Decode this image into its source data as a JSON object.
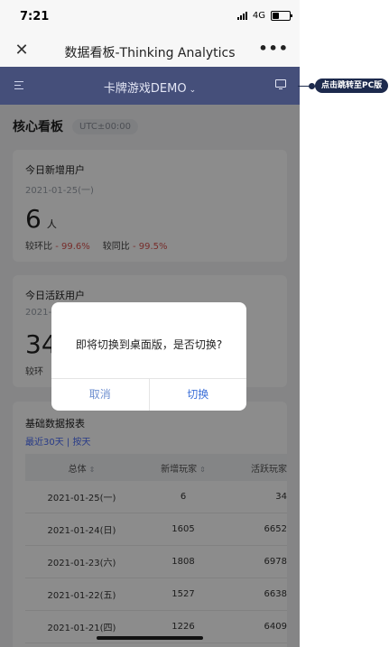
{
  "status_bar": {
    "time": "7:21",
    "network": "4G"
  },
  "title_bar": {
    "close_icon": "close-icon",
    "title": "数据看板-Thinking Analytics",
    "more_label": "•••"
  },
  "app_header": {
    "menu_icon": "menu-icon",
    "project": "卡牌游戏DEMO",
    "desktop_icon": "desktop-icon"
  },
  "section": {
    "title": "核心看板",
    "timezone": "UTC±00:00"
  },
  "card_new_users": {
    "title": "今日新增用户",
    "date": "2021-01-25(一)",
    "value": "6",
    "unit": "人",
    "mom_label": "较环比",
    "mom_value": "- 99.6%",
    "yoy_label": "较同比",
    "yoy_value": "- 99.5%"
  },
  "card_active_users": {
    "title": "今日活跃用户",
    "date_partial": "2021-",
    "value_partial": "34",
    "compare_partial": "较环"
  },
  "report": {
    "title": "基础数据报表",
    "subtitle": "最近30天 | 按天",
    "headers": [
      "总体",
      "新增玩家",
      "活跃玩家"
    ],
    "rows": [
      [
        "2021-01-25(一)",
        "6",
        "34"
      ],
      [
        "2021-01-24(日)",
        "1605",
        "6652"
      ],
      [
        "2021-01-23(六)",
        "1808",
        "6978"
      ],
      [
        "2021-01-22(五)",
        "1527",
        "6638"
      ],
      [
        "2021-01-21(四)",
        "1226",
        "6409"
      ]
    ]
  },
  "dialog": {
    "message": "即将切换到桌面版，是否切换?",
    "cancel": "取消",
    "confirm": "切换"
  },
  "callout": {
    "text": "点击跳转至PC版"
  },
  "colors": {
    "header_bg": "#454f7a",
    "accent": "#3b6fd8",
    "negative": "#d9534f",
    "callout_bg": "#1d2a4d"
  }
}
